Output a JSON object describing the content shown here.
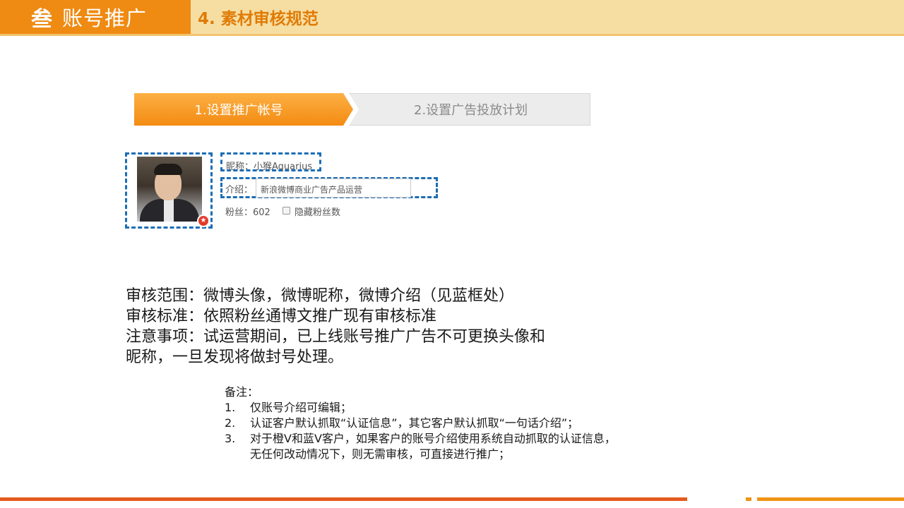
{
  "header": {
    "section_number": "叁",
    "section_title": "账号推广",
    "subtitle": "4. 素材审核规范"
  },
  "steps": [
    {
      "label": "1.设置推广帐号",
      "active": true
    },
    {
      "label": "2.设置广告投放计划",
      "active": false
    }
  ],
  "profile": {
    "nickname": "昵称：小猴Aquarius",
    "intro_label": "介绍：",
    "intro_value": "新浪微博商业广告产品运营",
    "fans": "粉丝：602",
    "hide_fans_label": "隐藏粉丝数",
    "hide_fans_checked": false
  },
  "rules": [
    "审核范围：微博头像，微博昵称，微博介绍（见蓝框处）",
    "审核标准：依照粉丝通博文推广现有审核标准",
    "注意事项：试运营期间，已上线账号推广广告不可更换头像和",
    "昵称，一旦发现将做封号处理。"
  ],
  "notes": {
    "title": "备注：",
    "items": [
      {
        "num": "1.",
        "text": "仅账号介绍可编辑；"
      },
      {
        "num": "2.",
        "text": "认证客户默认抓取“认证信息”，其它客户默认抓取“一句话介绍”；"
      },
      {
        "num": "3.",
        "text": "对于橙V和蓝V客户，如果客户的账号介绍使用系统自动抓取的认证信息，"
      },
      {
        "num": "",
        "text": "无任何改动情况下，则无需审核，可直接进行推广；"
      }
    ]
  },
  "colors": {
    "header_orange": "#ef8a12",
    "header_light": "#f6dea3",
    "highlight_blue": "#1c6db5",
    "footer_red": "#e35b1e"
  }
}
